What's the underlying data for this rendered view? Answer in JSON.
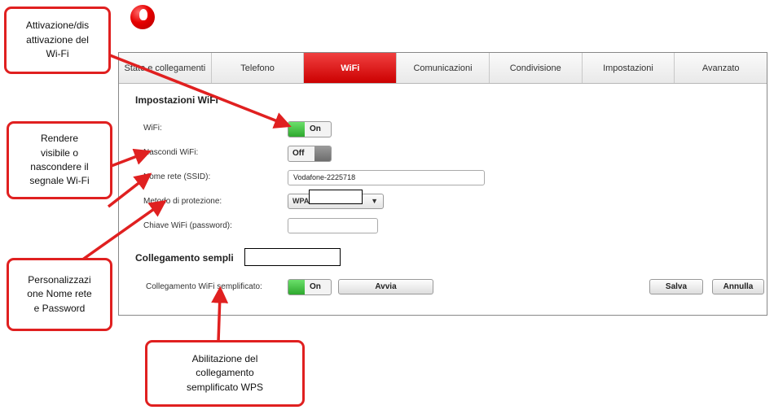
{
  "tabs": [
    {
      "label": "Stato e collegamenti",
      "active": false
    },
    {
      "label": "Telefono",
      "active": false
    },
    {
      "label": "WiFi",
      "active": true
    },
    {
      "label": "Comunicazioni",
      "active": false
    },
    {
      "label": "Condivisione",
      "active": false
    },
    {
      "label": "Impostazioni",
      "active": false
    },
    {
      "label": "Avanzato",
      "active": false
    }
  ],
  "wifi_settings": {
    "title": "Impostazioni WiFi",
    "wifi_label": "WiFi:",
    "wifi_toggle": "On",
    "hide_label": "Nascondi WiFi:",
    "hide_toggle": "Off",
    "ssid_label": "Nome rete (SSID):",
    "ssid_value": "Vodafone-2225718",
    "security_label": "Metodo di protezione:",
    "security_value": "WPA",
    "password_label": "Chiave WiFi (password):",
    "password_value": ""
  },
  "wps": {
    "title": "Collegamento sempli",
    "label": "Collegamento WiFi semplificato:",
    "toggle": "On",
    "start_button": "Avvia"
  },
  "actions": {
    "save": "Salva",
    "cancel": "Annulla"
  },
  "callouts": {
    "wifi_toggle": [
      "Attivazione/dis",
      "attivazione del",
      "Wi-Fi"
    ],
    "hide": [
      "Rendere",
      "visibile o",
      "nascondere il",
      "segnale Wi-Fi"
    ],
    "custom": [
      "Personalizzazi",
      "one Nome rete",
      "e Password"
    ],
    "wps": [
      "Abilitazione del",
      "collegamento",
      "semplificato WPS"
    ]
  },
  "colors": {
    "accent": "#e60000",
    "callout_border": "#e02020",
    "toggle_on": "#3cbc3c"
  },
  "icons": {
    "logo": "vodafone-logo",
    "dropdown": "chevron-down-icon"
  }
}
